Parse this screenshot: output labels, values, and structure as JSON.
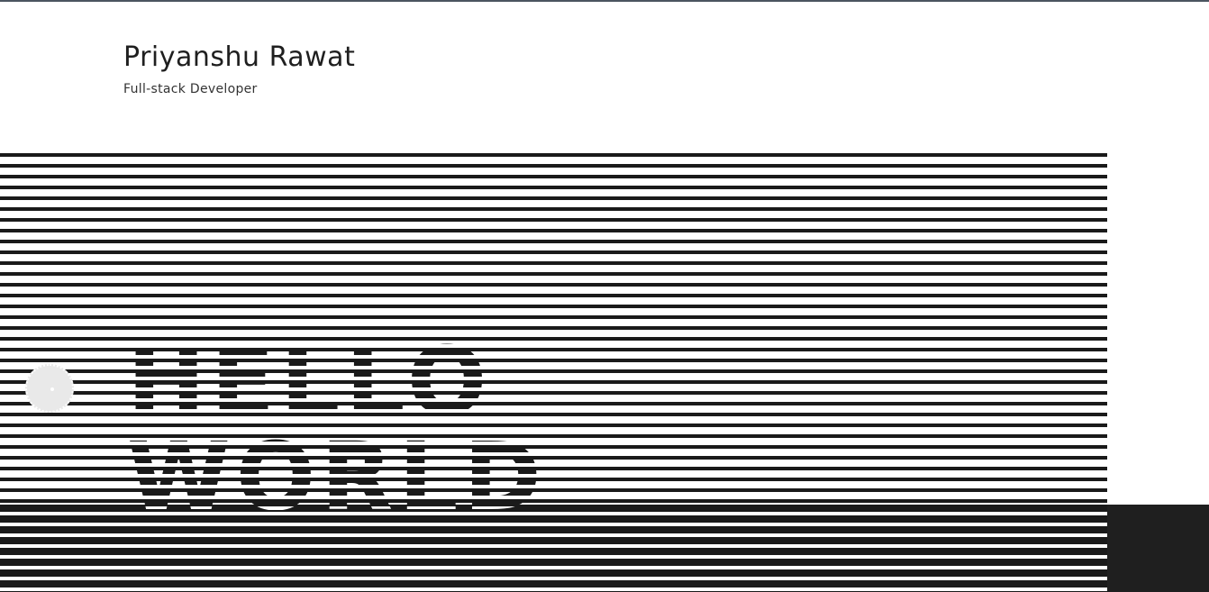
{
  "header": {
    "name": "Priyanshu Rawat",
    "role": "Full-stack Developer"
  },
  "hero": {
    "lines": [
      "HELLO",
      "WORLD"
    ]
  },
  "colors": {
    "stripe": "#1a1a1a",
    "background": "#ffffff",
    "corner_block": "#1f1f1f",
    "top_border": "#4b5560"
  },
  "icons": {
    "dial": "round-dial-icon"
  }
}
